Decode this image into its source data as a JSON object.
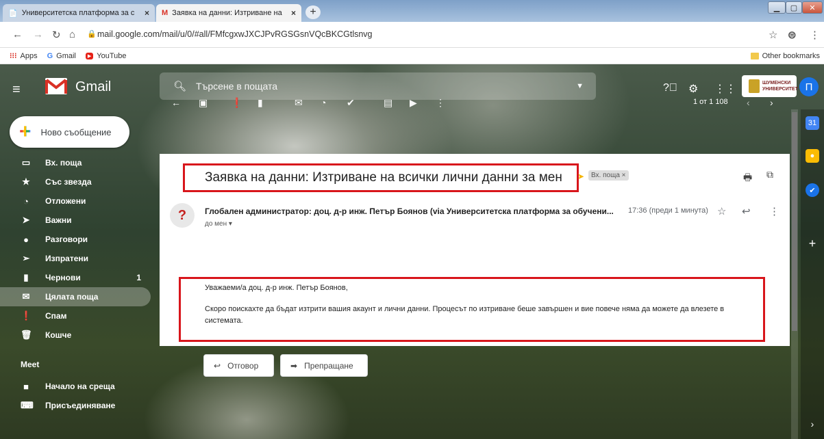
{
  "browser": {
    "tabs": [
      {
        "title": "Университетска платформа за с",
        "close": "×"
      },
      {
        "title": "Заявка на данни: Изтриване на",
        "close": "×"
      }
    ],
    "new_tab": "+",
    "url": "mail.google.com/mail/u/0/#all/FMfcgxwJXCJPvRGSGsnVQcBKCGtlsnvg",
    "bookmarks": [
      "Apps",
      "Gmail",
      "YouTube"
    ],
    "other_bookmarks": "Other bookmarks"
  },
  "gmail": {
    "app_name": "Gmail",
    "search_placeholder": "Търсене в пощата",
    "avatar_letter": "П",
    "university_logo_text": "ШУМЕНСКИ УНИВЕРСИТЕТ",
    "compose": "Ново съобщение",
    "nav": [
      {
        "label": "Вх. поща",
        "icon": "inbox-icon"
      },
      {
        "label": "Със звезда",
        "icon": "star-icon"
      },
      {
        "label": "Отложени",
        "icon": "clock-icon"
      },
      {
        "label": "Важни",
        "icon": "important-icon"
      },
      {
        "label": "Разговори",
        "icon": "chat-icon"
      },
      {
        "label": "Изпратени",
        "icon": "send-icon"
      },
      {
        "label": "Чернови",
        "icon": "draft-icon",
        "count": "1"
      },
      {
        "label": "Цялата поща",
        "icon": "mail-icon",
        "active": true
      },
      {
        "label": "Спам",
        "icon": "spam-icon"
      },
      {
        "label": "Кошче",
        "icon": "trash-icon"
      }
    ],
    "meet_title": "Meet",
    "meet": [
      {
        "label": "Начало на среща",
        "icon": "video-icon"
      },
      {
        "label": "Присъединяване",
        "icon": "keyboard-icon"
      }
    ],
    "page_count": "1 от 1 108"
  },
  "message": {
    "subject": "Заявка на данни: Изтриване на всички лични данни за мен",
    "label": "Вх. поща ×",
    "sender": "Глобален администратор: доц. д-р инж. Петър Боянов (via Университетска платформа за обучени...",
    "to": "до мен ▾",
    "time": "17:36 (преди 1 минута)",
    "greeting": "Уважаеми/а доц. д-р инж. Петър Боянов,",
    "body": "Скоро поискахте да бъдат изтрити вашия акаунт и лични данни. Процесът по изтриване беше завършен и вие повече няма да можете да влезете в системата.",
    "reply": "Отговор",
    "forward": "Препращане"
  },
  "colors": {
    "highlight": "#d8151b",
    "accent": "#1a73e8"
  }
}
